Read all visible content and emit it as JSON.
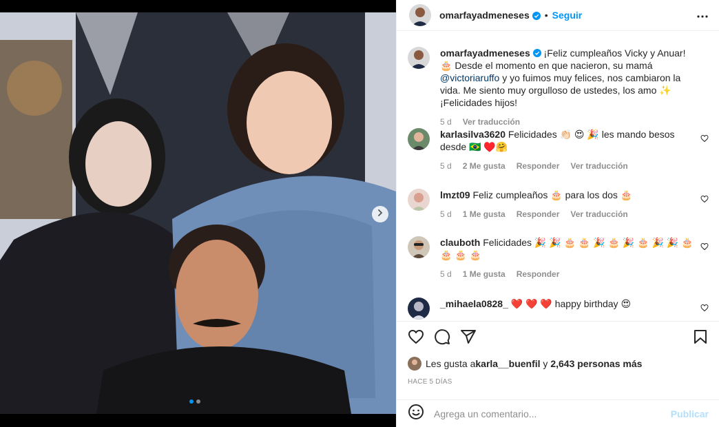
{
  "post": {
    "author": "omarfayadmeneses",
    "follow_label": "Seguir",
    "separator": "•"
  },
  "caption": {
    "username": "omarfayadmeneses",
    "text_1": " ¡Feliz cumpleaños Vicky y Anuar! 🎂 Desde el momento en que nacieron, su mamá ",
    "mention": "@victoriaruffo",
    "text_2": " y yo fuimos muy felices, nos cambiaron la vida. Me siento muy orgulloso de ustedes, los amo ✨ ¡Felicidades hijos!",
    "time": "5 d",
    "translate": "Ver traducción"
  },
  "comments": [
    {
      "username": "karlasilva3620",
      "text": " Felicidades 👏🏻 😍 🎉  les mando besos desde 🇧🇷 ♥️🤗",
      "time": "5 d",
      "likes": "2 Me gusta",
      "reply": "Responder",
      "translate": "Ver traducción"
    },
    {
      "username": "lmzt09",
      "text": " Feliz cumpleaños 🎂 para los dos 🎂",
      "time": "5 d",
      "likes": "1 Me gusta",
      "reply": "Responder",
      "translate": "Ver traducción"
    },
    {
      "username": "clauboth",
      "text": " Felicidades 🎉 🎉 🎂 🎂 🎉 🎂 🎉 🎂 🎉 🎉 🎂 🎂 🎂 🎂",
      "time": "5 d",
      "likes": "1 Me gusta",
      "reply": "Responder"
    },
    {
      "username": "_mihaela0828_",
      "text": " ❤️ ❤️ ❤️  happy birthday 😍"
    }
  ],
  "likes": {
    "prefix": "Les gusta a ",
    "user": "karla__buenfil",
    "mid": " y ",
    "count": "2,643 personas más"
  },
  "posted_ago": "HACE 5 DÍAS",
  "add_comment": {
    "placeholder": "Agrega un comentario...",
    "publish": "Publicar"
  },
  "colors": {
    "accent": "#0095f6",
    "mention": "#00376b",
    "muted": "#8e8e8e",
    "publish_disabled": "#b2dffc",
    "verified": "#0095f6"
  },
  "icons": [
    "verified-icon",
    "more-icon",
    "heart-icon",
    "comment-icon",
    "share-icon",
    "save-icon",
    "emoji-icon",
    "next-arrow-icon"
  ]
}
